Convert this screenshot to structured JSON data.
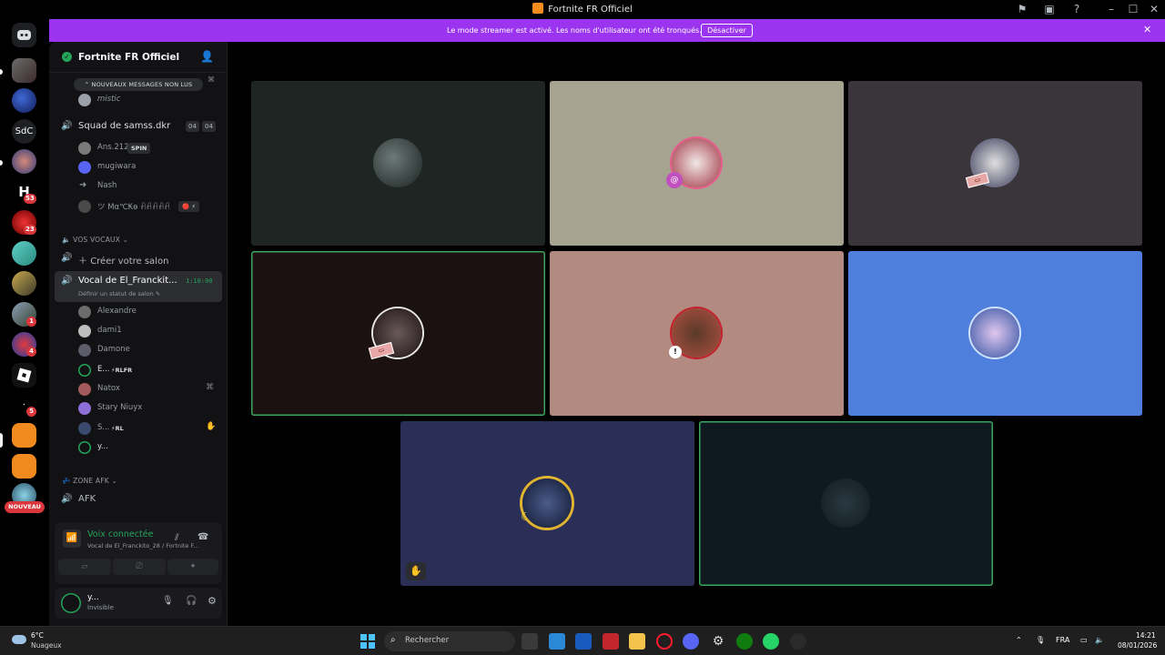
{
  "window": {
    "title": "Fortnite FR Officiel"
  },
  "banner": {
    "text": "Le mode streamer est activé. Les noms d'utilisateur ont été tronqués.",
    "button": "Désactiver"
  },
  "rail": {
    "servers": [
      {
        "initials": "SdC"
      },
      {
        "badge": "53"
      },
      {
        "badge": "23"
      },
      {
        "badge": "1"
      },
      {
        "badge": "4"
      },
      {
        "badge": "5"
      },
      {
        "badge": "NOUVEAU"
      }
    ]
  },
  "server": {
    "name": "Fortnite FR Officiel",
    "unread_label": "NOUVEAUX MESSAGES NON LUS"
  },
  "channels": {
    "top_user": "mistic",
    "squad_channel": {
      "name": "Squad de samss.dkr",
      "count_a": "04",
      "count_b": "04"
    },
    "squad_members": [
      {
        "name": "Ans.212",
        "tag": "SPIN"
      },
      {
        "name": "mugiwara"
      },
      {
        "name": "Nash"
      },
      {
        "name": "ツ Mα℃₭ɵ ꋬꋬꋬꋬꋬ",
        "tag": "🔴 ⚡"
      }
    ],
    "voice_category": "VOS VOCAUX",
    "create_label": "Créer votre salon",
    "active_channel": {
      "name": "Vocal de El_Franckit...",
      "timer": "1:10:00",
      "status": "Définir un statut de salon"
    },
    "voice_members": [
      {
        "name": "Alexandre"
      },
      {
        "name": "dami1"
      },
      {
        "name": "Damone"
      },
      {
        "name": "E...",
        "tag": "⚡RLFR"
      },
      {
        "name": "Natox"
      },
      {
        "name": "Stary Niuyx"
      },
      {
        "name": "S...",
        "tag": "⚡RL"
      },
      {
        "name": "y..."
      }
    ],
    "afk_category": "ZONE AFK",
    "afk_channel": "AFK"
  },
  "voice_panel": {
    "title": "Voix connectée",
    "subtitle": "Vocal de El_Franckito_28 / Fortnite F..."
  },
  "user_panel": {
    "name": "y...",
    "status": "Invisible"
  },
  "taskbar": {
    "weather_temp": "6°C",
    "weather_desc": "Nuageux",
    "search_placeholder": "Rechercher",
    "language": "FRA",
    "time": "14:21",
    "date": "08/01/2026"
  },
  "colors": {
    "brand_purple": "#9b34ef",
    "speaking_green": "#3ba55d",
    "online_green": "#23a55a",
    "badge_red": "#da373c"
  }
}
